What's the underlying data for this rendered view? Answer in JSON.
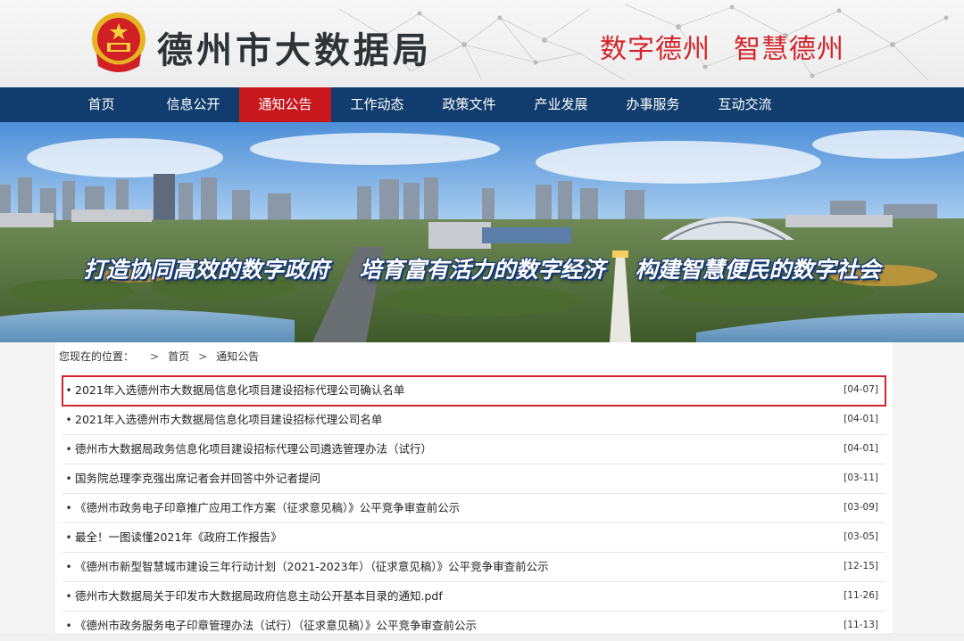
{
  "header": {
    "site_title": "德州市大数据局",
    "slogan_1": "数字德州",
    "slogan_2": "智慧德州"
  },
  "nav": {
    "items": [
      "首页",
      "信息公开",
      "通知公告",
      "工作动态",
      "政策文件",
      "产业发展",
      "办事服务",
      "互动交流"
    ],
    "active_index": 2
  },
  "banner": {
    "slogan_1": "打造协同高效的数字政府",
    "slogan_2": "培育富有活力的数字经济",
    "slogan_3": "构建智慧便民的数字社会"
  },
  "breadcrumb": {
    "prefix": "您现在的位置：",
    "sep": ">",
    "home": "首页",
    "current": "通知公告"
  },
  "notices": [
    {
      "title": "2021年入选德州市大数据局信息化项目建设招标代理公司确认名单",
      "date": "[04-07]",
      "highlighted": true
    },
    {
      "title": "2021年入选德州市大数据局信息化项目建设招标代理公司名单",
      "date": "[04-01]"
    },
    {
      "title": "德州市大数据局政务信息化项目建设招标代理公司遴选管理办法（试行）",
      "date": "[04-01]"
    },
    {
      "title": "国务院总理李克强出席记者会并回答中外记者提问",
      "date": "[03-11]"
    },
    {
      "title": "《德州市政务电子印章推广应用工作方案（征求意见稿）》公平竞争审查前公示",
      "date": "[03-09]"
    },
    {
      "title": "最全！一图读懂2021年《政府工作报告》",
      "date": "[03-05]"
    },
    {
      "title": "《德州市新型智慧城市建设三年行动计划（2021-2023年）（征求意见稿）》公平竞争审查前公示",
      "date": "[12-15]"
    },
    {
      "title": "德州市大数据局关于印发市大数据局政府信息主动公开基本目录的通知.pdf",
      "date": "[11-26]"
    },
    {
      "title": "《德州市政务服务电子印章管理办法（试行）（征求意见稿）》公平竞争审查前公示",
      "date": "[11-13]"
    }
  ],
  "bullet": "•",
  "colors": {
    "nav_bg": "#103d6d",
    "active": "#c9171e",
    "slogan": "#d3242b"
  }
}
